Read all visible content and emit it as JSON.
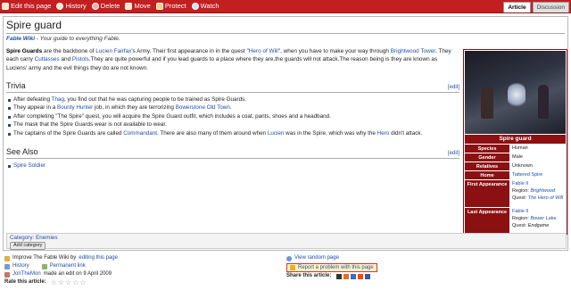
{
  "toolbar": {
    "actions": [
      {
        "label": "Edit this page",
        "icon": "edit-icon"
      },
      {
        "label": "History",
        "icon": "history-icon"
      },
      {
        "label": "Delete",
        "icon": "delete-icon"
      },
      {
        "label": "Move",
        "icon": "move-icon"
      },
      {
        "label": "Protect",
        "icon": "protect-icon"
      },
      {
        "label": "Watch",
        "icon": "watch-icon"
      }
    ],
    "tabs": [
      "Article",
      "Discussion"
    ]
  },
  "page": {
    "title": "Spire guard",
    "site_sub_link": "Fable Wiki",
    "site_sub_rest": " - Your guide to everything Fable."
  },
  "intro": {
    "bold": "Spire Guards",
    "t1": " are the backbone of ",
    "l1": "Lucien Fairfax",
    "t2": "'s Army. Their first appearance in in the quest \"",
    "l2": "Hero of Will",
    "t3": "\", when you have to make your way through ",
    "l3": "Brightwood Tower",
    "t4": ". They each carry ",
    "l4": "Cutlasses",
    "t5": " and ",
    "l5": "Pistols",
    "t6": ".They are quite powerful and if you lead guards to a place where they are,the guards will not attack.The reason being is they are known as Luciens' army and the evil things they do are not known."
  },
  "trivia": {
    "heading": "Trivia",
    "edit": "[edit]",
    "items": [
      {
        "a": "After defeating ",
        "l": "Thag",
        "b": ", you find out that he was capturing people to be trained as Spire Guards."
      },
      {
        "a": "They appear in a ",
        "l": "Bounty Hunter",
        "b": " job, in which they are terrorizing ",
        "l2": "Bowerstone Old Town",
        "c": "."
      },
      {
        "a": "After completing \"The Spire\" quest, you will acquire the Spire Guard outfit, which includes a coat, pants, shoes and a headband."
      },
      {
        "a": "The mask that the Spire Guards wear is not available to wear."
      },
      {
        "a": "The captains of the Spire Guards are called ",
        "l": "Commandant",
        "b": ". There are also many of them around when ",
        "l2": "Lucien",
        "c": " was in the Spire, which was why the ",
        "l3": "Hero",
        "d": " didn't attack."
      }
    ]
  },
  "see_also": {
    "heading": "See Also",
    "edit": "[edit]",
    "items": [
      "Spire Soldier"
    ]
  },
  "infobox": {
    "title": "Spire guard",
    "species_k": "Species",
    "species_v": "Human",
    "gender_k": "Gender",
    "gender_v": "Male",
    "relatives_k": "Relatives",
    "relatives_v": "Unknown",
    "home_k": "Home",
    "home_v": "Tattered Spire",
    "first_k": "First Appearance",
    "first_game": "Fable II",
    "first_region_k": "Region:",
    "first_region_v": "Brightwood",
    "first_quest_k": "Quest:",
    "first_quest_v": "The Hero of Will",
    "last_k": "Last Appearance",
    "last_game": "Fable II",
    "last_region_k": "Region:",
    "last_region_v": "Bower Lake",
    "last_quest_k": "Quest:",
    "last_quest_v": "Endgame"
  },
  "categories": {
    "label": "Category",
    "sep": ": ",
    "value": "Enemies",
    "add": "Add category"
  },
  "footer": {
    "improve_pre": "Improve The Fable Wiki by ",
    "improve_link": "editing this page",
    "history": "History",
    "permalink": "Permanent link",
    "editor": "JonTheMon",
    "edit_note": " made an edit on 9 April 2009",
    "rate": "Rate this article:",
    "random": "View random page",
    "report": "Report a problem with this page",
    "share": "Share this article:"
  },
  "colors": {
    "accent": "#c31f21",
    "infobox": "#8b1012",
    "link": "#1f4fa8"
  }
}
